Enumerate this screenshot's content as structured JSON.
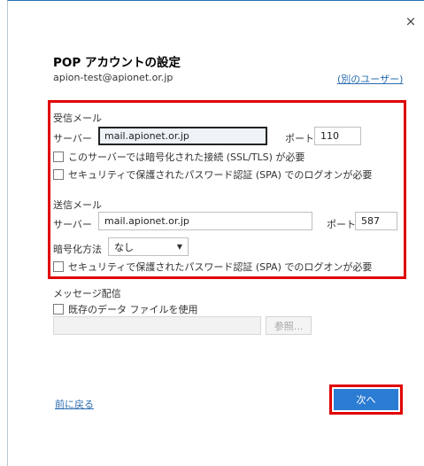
{
  "dialog": {
    "close_glyph": "×",
    "title": "POP アカウントの設定",
    "email": "apion-test@apionet.or.jp",
    "other_user_link": "(別のユーザー)"
  },
  "incoming": {
    "heading": "受信メール",
    "server_label": "サーバー",
    "server_value": "mail.apionet.or.jp",
    "port_label": "ポート",
    "port_value": "110",
    "ssl_checkbox_label": "このサーバーでは暗号化された接続 (SSL/TLS) が必要",
    "ssl_checked": false,
    "spa_checkbox_label": "セキュリティで保護されたパスワード認証 (SPA) でのログオンが必要",
    "spa_checked": false
  },
  "outgoing": {
    "heading": "送信メール",
    "server_label": "サーバー",
    "server_value": "mail.apionet.or.jp",
    "port_label": "ポート",
    "port_value": "587",
    "encryption_label": "暗号化方法",
    "encryption_value": "なし",
    "spa_checkbox_label": "セキュリティで保護されたパスワード認証 (SPA) でのログオンが必要",
    "spa_checked": false
  },
  "delivery": {
    "heading": "メッセージ配信",
    "existing_file_label": "既存のデータ ファイルを使用",
    "existing_file_checked": false,
    "file_path_value": "",
    "browse_label": "参照..."
  },
  "footer": {
    "back_label": "前に戻る",
    "next_label": "次へ"
  },
  "colors": {
    "accent": "#2b7cd3",
    "highlight_border": "#e00000",
    "link": "#2b6cb0"
  }
}
